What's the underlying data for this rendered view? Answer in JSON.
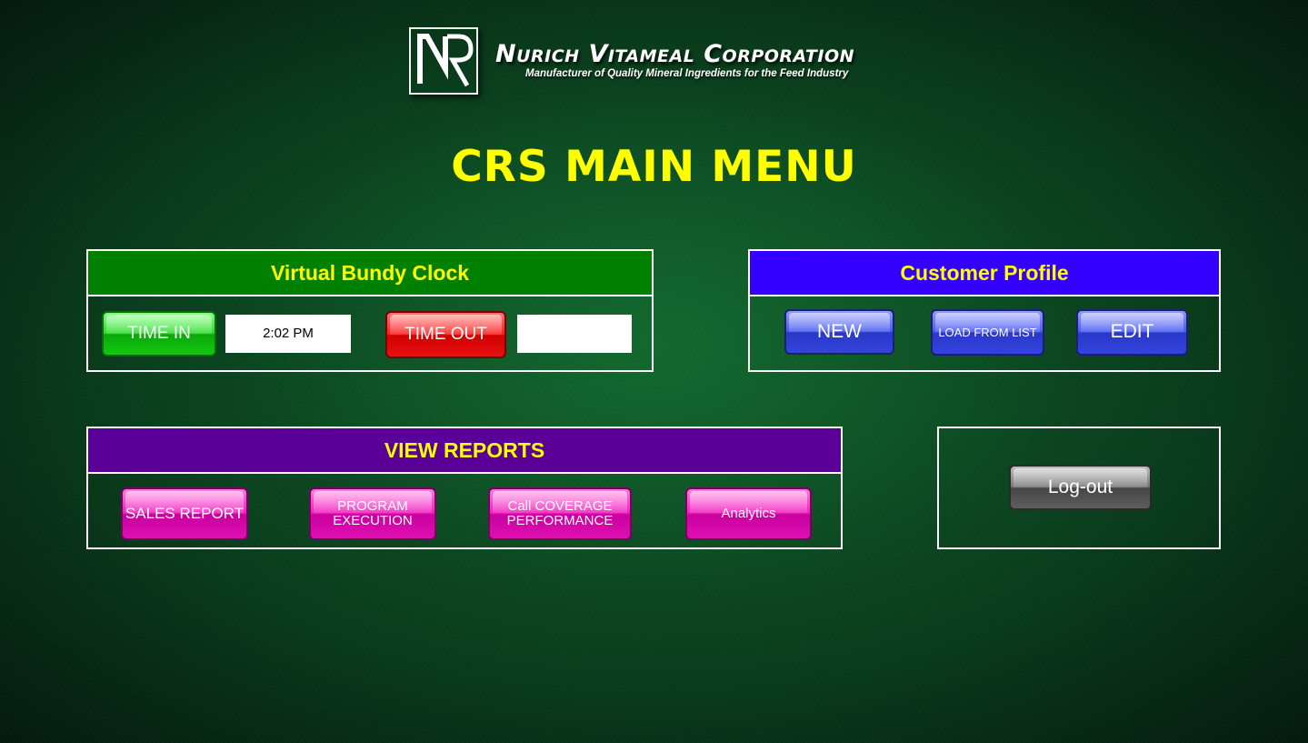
{
  "brand": {
    "logo_letters": "NR",
    "name": "Nurich Vitameal Corporation",
    "tagline": "Manufacturer of Quality Mineral Ingredients for the Feed Industry"
  },
  "title": "CRS MAIN MENU",
  "bundy_clock": {
    "header": "Virtual Bundy Clock",
    "time_in_label": "TIME IN",
    "time_in_value": "2:02 PM",
    "time_out_label": "TIME OUT",
    "time_out_value": ""
  },
  "customer_profile": {
    "header": "Customer Profile",
    "new_label": "NEW",
    "load_label": "LOAD FROM LIST",
    "edit_label": "EDIT"
  },
  "reports": {
    "header": "VIEW REPORTS",
    "sales_label": "SALES REPORT",
    "program_label_1": "PROGRAM",
    "program_label_2": "EXECUTION",
    "coverage_label_1": "Call COVERAGE",
    "coverage_label_2": "PERFORMANCE",
    "analytics_label": "Analytics"
  },
  "logout_label": "Log-out",
  "colors": {
    "title_yellow": "#ffff00",
    "bundy_header": "#008000",
    "customer_header": "#3300ff",
    "reports_header": "#5a0099"
  }
}
